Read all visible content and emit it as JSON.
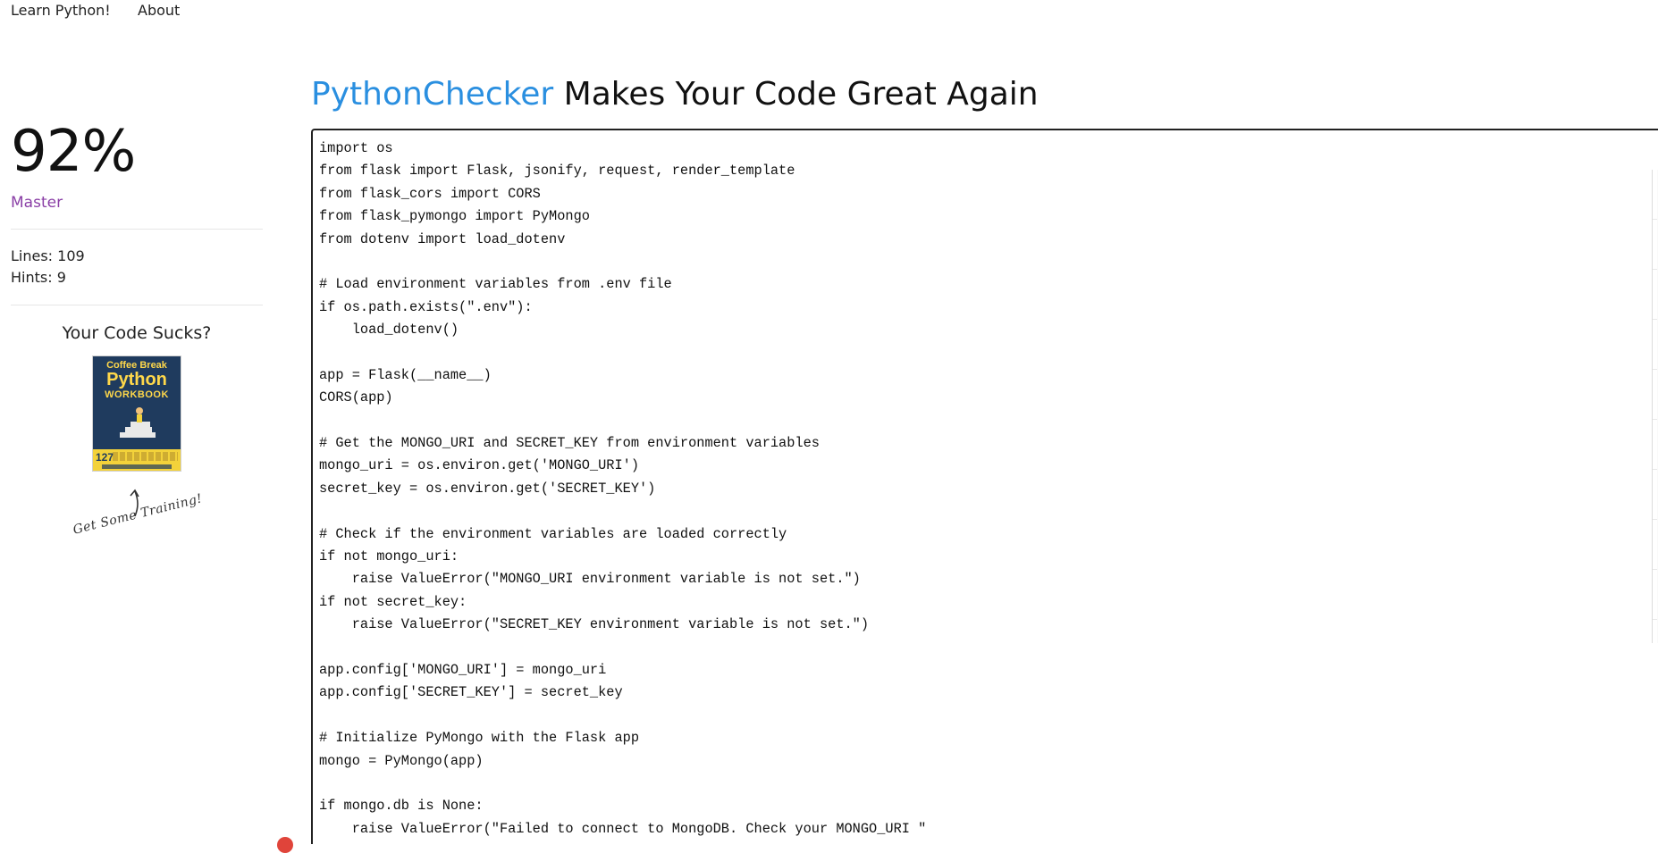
{
  "nav": {
    "learn": "Learn Python!",
    "about": "About"
  },
  "sidebar": {
    "score": "92%",
    "rank": "Master",
    "lines": "Lines: 109",
    "hints": "Hints: 9",
    "promo_title": "Your Code Sucks?",
    "book": {
      "line1": "Coffee Break",
      "line2": "Python",
      "line3": "WORKBOOK",
      "count": "127"
    },
    "training": "Get Some Training!"
  },
  "header": {
    "brand": "PythonChecker",
    "tagline": " Makes Your Code Great Again"
  },
  "editor": {
    "code_lines": [
      "import os",
      "from flask import Flask, jsonify, request, render_template",
      "from flask_cors import CORS",
      "from flask_pymongo import PyMongo",
      "from dotenv import load_dotenv",
      "",
      "# Load environment variables from .env file",
      "if os.path.exists(\".env\"):",
      "    load_dotenv()",
      "",
      "app = Flask(__name__)",
      "CORS(app)",
      "",
      "# Get the MONGO_URI and SECRET_KEY from environment variables",
      "mongo_uri = os.environ.get('MONGO_URI')",
      "secret_key = os.environ.get('SECRET_KEY')",
      "",
      "# Check if the environment variables are loaded correctly",
      "if not mongo_uri:",
      "    raise ValueError(\"MONGO_URI environment variable is not set.\")",
      "if not secret_key:",
      "    raise ValueError(\"SECRET_KEY environment variable is not set.\")",
      "",
      "app.config['MONGO_URI'] = mongo_uri",
      "app.config['SECRET_KEY'] = secret_key",
      "",
      "# Initialize PyMongo with the Flask app",
      "mongo = PyMongo(app)",
      "",
      "if mongo.db is None:",
      "    raise ValueError(\"Failed to connect to MongoDB. Check your MONGO_URI \""
    ]
  },
  "colors": {
    "brand": "#2a8fe0",
    "rank": "#8a3fa6",
    "badge": "#e0443a"
  }
}
